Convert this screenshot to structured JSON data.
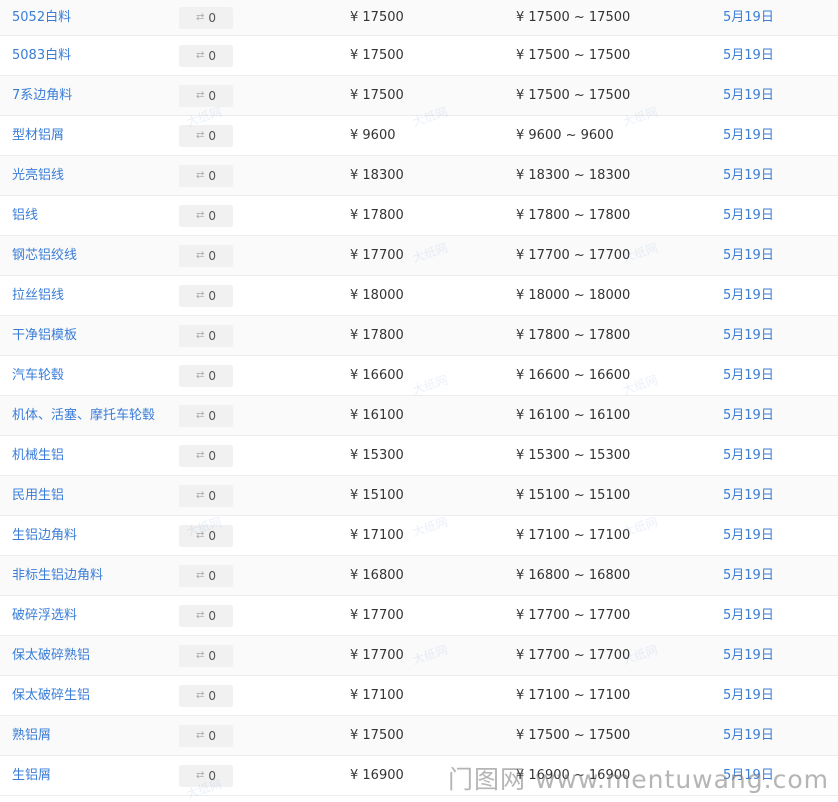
{
  "rows": [
    {
      "name": "5052白料",
      "change": "0",
      "price": "¥ 17500",
      "range": "¥ 17500 ~ 17500",
      "date": "5月19日"
    },
    {
      "name": "5083白料",
      "change": "0",
      "price": "¥ 17500",
      "range": "¥ 17500 ~ 17500",
      "date": "5月19日"
    },
    {
      "name": "7系边角料",
      "change": "0",
      "price": "¥ 17500",
      "range": "¥ 17500 ~ 17500",
      "date": "5月19日"
    },
    {
      "name": "型材铝屑",
      "change": "0",
      "price": "¥ 9600",
      "range": "¥ 9600 ~ 9600",
      "date": "5月19日"
    },
    {
      "name": "光亮铝线",
      "change": "0",
      "price": "¥ 18300",
      "range": "¥ 18300 ~ 18300",
      "date": "5月19日"
    },
    {
      "name": "铝线",
      "change": "0",
      "price": "¥ 17800",
      "range": "¥ 17800 ~ 17800",
      "date": "5月19日"
    },
    {
      "name": "钢芯铝绞线",
      "change": "0",
      "price": "¥ 17700",
      "range": "¥ 17700 ~ 17700",
      "date": "5月19日"
    },
    {
      "name": "拉丝铝线",
      "change": "0",
      "price": "¥ 18000",
      "range": "¥ 18000 ~ 18000",
      "date": "5月19日"
    },
    {
      "name": "干净铝模板",
      "change": "0",
      "price": "¥ 17800",
      "range": "¥ 17800 ~ 17800",
      "date": "5月19日"
    },
    {
      "name": "汽车轮毂",
      "change": "0",
      "price": "¥ 16600",
      "range": "¥ 16600 ~ 16600",
      "date": "5月19日"
    },
    {
      "name": "机体、活塞、摩托车轮毂",
      "change": "0",
      "price": "¥ 16100",
      "range": "¥ 16100 ~ 16100",
      "date": "5月19日"
    },
    {
      "name": "机械生铝",
      "change": "0",
      "price": "¥ 15300",
      "range": "¥ 15300 ~ 15300",
      "date": "5月19日"
    },
    {
      "name": "民用生铝",
      "change": "0",
      "price": "¥ 15100",
      "range": "¥ 15100 ~ 15100",
      "date": "5月19日"
    },
    {
      "name": "生铝边角料",
      "change": "0",
      "price": "¥ 17100",
      "range": "¥ 17100 ~ 17100",
      "date": "5月19日"
    },
    {
      "name": "非标生铝边角料",
      "change": "0",
      "price": "¥ 16800",
      "range": "¥ 16800 ~ 16800",
      "date": "5月19日"
    },
    {
      "name": "破碎浮选料",
      "change": "0",
      "price": "¥ 17700",
      "range": "¥ 17700 ~ 17700",
      "date": "5月19日"
    },
    {
      "name": "保太破碎熟铝",
      "change": "0",
      "price": "¥ 17700",
      "range": "¥ 17700 ~ 17700",
      "date": "5月19日"
    },
    {
      "name": "保太破碎生铝",
      "change": "0",
      "price": "¥ 17100",
      "range": "¥ 17100 ~ 17100",
      "date": "5月19日"
    },
    {
      "name": "熟铝屑",
      "change": "0",
      "price": "¥ 17500",
      "range": "¥ 17500 ~ 17500",
      "date": "5月19日"
    },
    {
      "name": "生铝屑",
      "change": "0",
      "price": "¥ 16900",
      "range": "¥ 16900 ~ 16900",
      "date": "5月19日"
    }
  ],
  "watermark": {
    "text": "大纸网",
    "footer": "门图网 www.mentuwang.com"
  },
  "icons": {
    "change": "flat-arrow-icon"
  },
  "colors": {
    "link": "#3a7dd8",
    "row_alt": "#fafafa",
    "divider": "#ececec",
    "badge_bg": "#f1f1f1"
  }
}
